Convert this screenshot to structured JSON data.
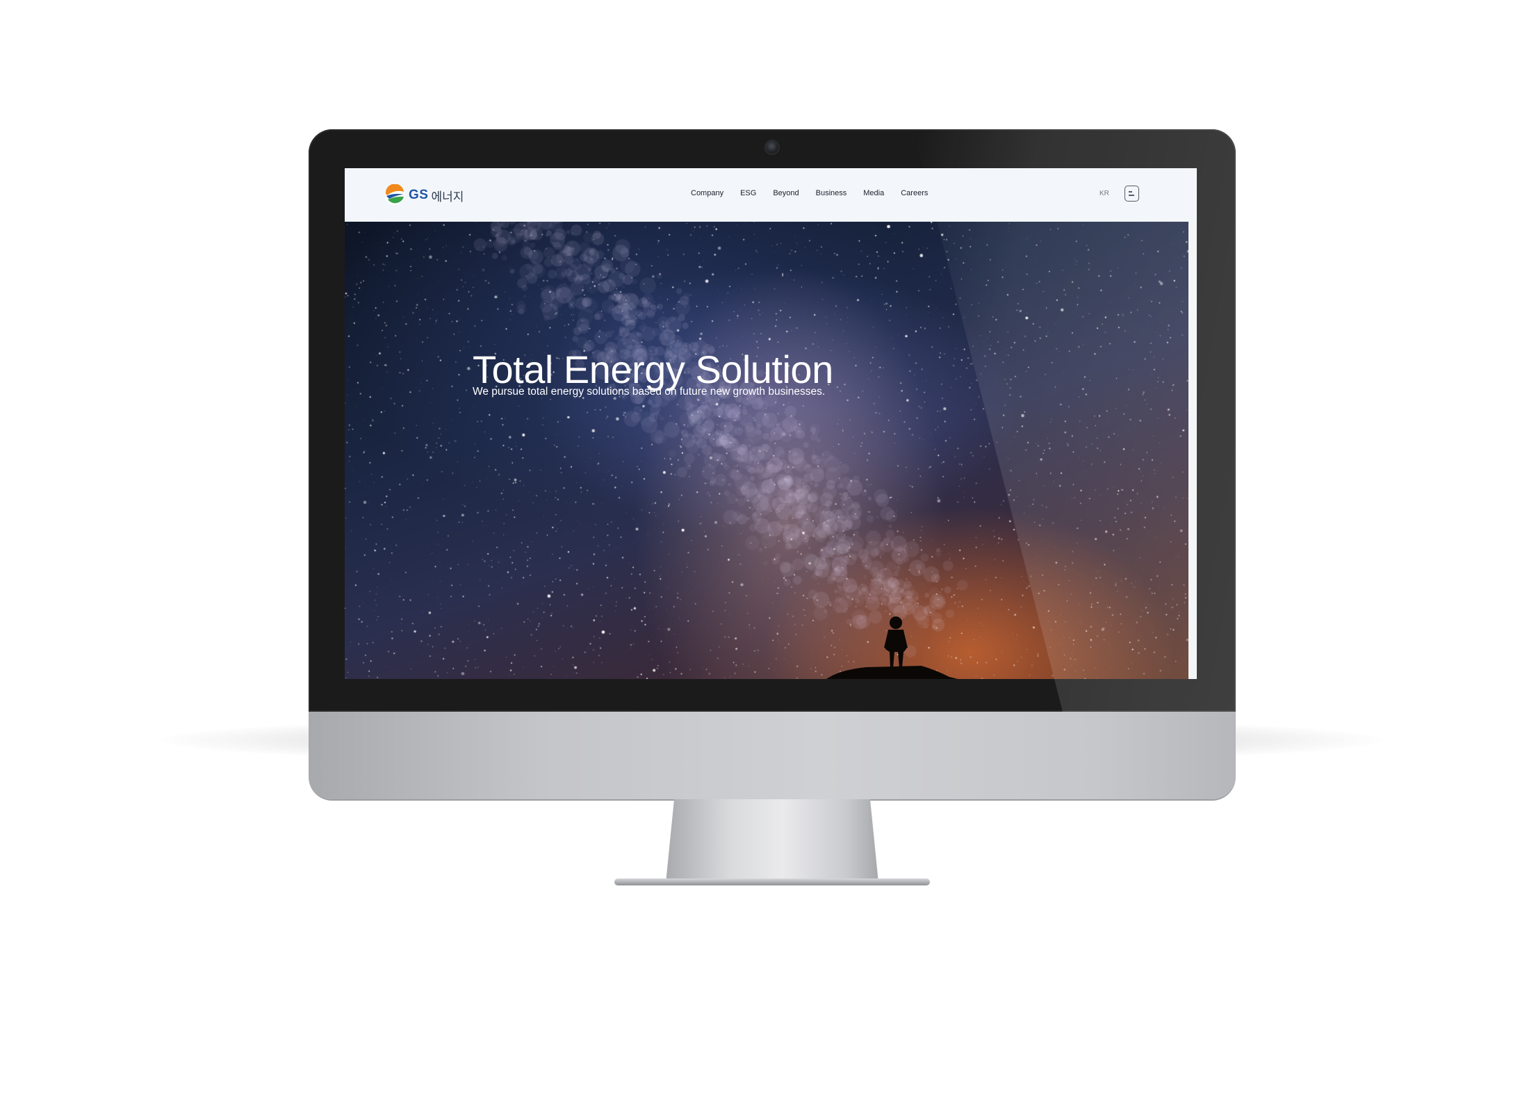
{
  "header": {
    "logo": {
      "brand": "GS",
      "name_ko": "에너지"
    },
    "nav": [
      "Company",
      "ESG",
      "Beyond",
      "Business",
      "Media",
      "Careers"
    ],
    "lang": "KR",
    "menu_icon": "menu-icon"
  },
  "hero": {
    "title": "Total Energy Solution",
    "subtitle": "We pursue total energy solutions based on future new growth businesses."
  },
  "colors": {
    "header_bg": "#f3f7fc",
    "brand_blue": "#1f56a3",
    "logo_orange": "#f08a1c",
    "logo_green": "#3aa34a",
    "bezel": "#1b1b1c",
    "chin": "#c4c5c9"
  }
}
